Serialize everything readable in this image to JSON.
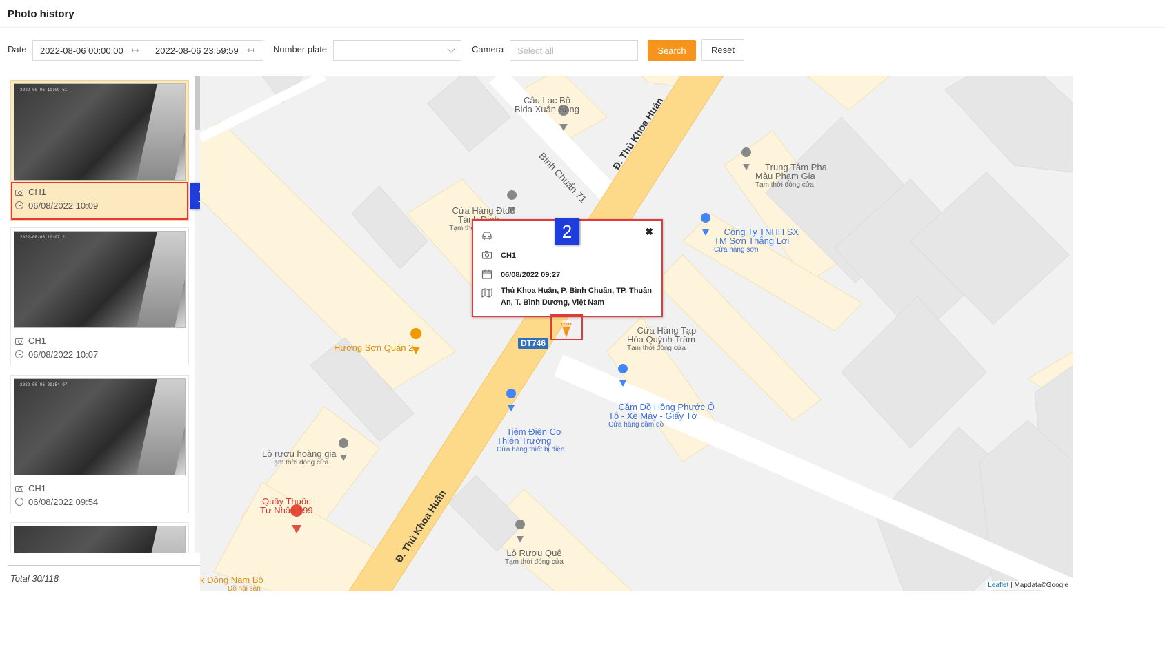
{
  "page": {
    "title": "Photo history"
  },
  "filters": {
    "date_label": "Date",
    "date_from": "2022-08-06 00:00:00",
    "date_to": "2022-08-06 23:59:59",
    "plate_label": "Number plate",
    "plate_value": "",
    "camera_label": "Camera",
    "camera_placeholder": "Select all",
    "search_label": "Search",
    "reset_label": "Reset"
  },
  "photos": [
    {
      "camera": "CH1",
      "time": "06/08/2022 10:09",
      "active": true
    },
    {
      "camera": "CH1",
      "time": "06/08/2022 10:07",
      "active": false
    },
    {
      "camera": "CH1",
      "time": "06/08/2022 09:54",
      "active": false
    }
  ],
  "total": "Total 30/118",
  "annotations": {
    "badge1": "1",
    "badge2": "2"
  },
  "popup": {
    "vehicle_icon": "car-icon",
    "camera": "CH1",
    "time": "06/08/2022 09:27",
    "address": "Thủ Khoa Huân, P. Bình Chuẩn, TP. Thuận An, T. Bình Dương, Việt Nam"
  },
  "map": {
    "roads": {
      "main": "Đ. Thủ Khoa Huân",
      "side": "Bình Chuẩn 71",
      "route": "DT746"
    },
    "pois": {
      "caulacbo": "Câu Lạc Bộ\nBida Xuân Sang",
      "cuahangdtdd": "Cửa Hàng Đtdđ\nTánh Định",
      "cuahangdtdd_sub": "Tạm thời đóng cửa",
      "trungtam": "Trung Tâm Pha\nMàu Phạm Gia",
      "trungtam_sub": "Tạm thời đóng cửa",
      "congty": "Công Ty TNHH SX\nTM Sơn Thắng Lợi",
      "congty_sub": "Cửa hàng sơn",
      "cuahangtaphoa": "Cửa Hàng Tạp\nHóa Quỳnh Trâm",
      "cuahangtaphoa_sub": "Tạm thời đóng cửa",
      "huongson": "Hương Sơn Quán 2",
      "camdo": "Cầm Đồ Hồng Phước Ô\nTô - Xe Máy - Giấy Tờ",
      "camdo_sub": "Cửa hàng cầm đồ",
      "tiemdien": "Tiệm Điện Cơ\nThiên Trường",
      "tiemdien_sub": "Cửa hàng thiết bị điện",
      "loruouhoang": "Lò rượu hoàng gia",
      "loruouhoang_sub": "Tạm thời đóng cửa",
      "quaythuoc": "Quầy Thuốc\nTư Nhân 199",
      "loruouque": "Lò Rượu Quê",
      "loruouque_sub": "Tạm thời đóng cửa",
      "dongnambo": "k Đông Nam Bộ",
      "dongnambo_sub": "Đồ hải sản"
    },
    "attribution_leaflet": "Leaflet",
    "attribution_rest": " | Mapdata©Google"
  },
  "colors": {
    "accent": "#f7941d",
    "highlight": "#e53935",
    "badge": "#1e3ddb",
    "active_card": "#fde9c0"
  }
}
